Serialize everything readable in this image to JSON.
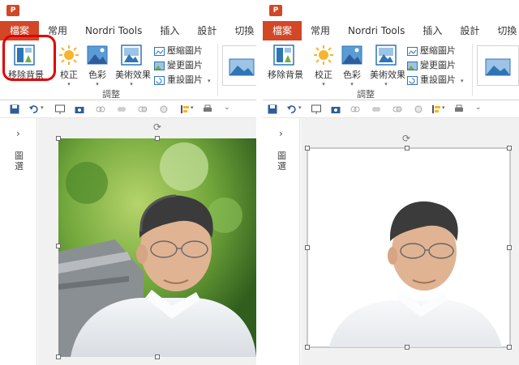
{
  "app_icon_letter": "P",
  "tabs": [
    "檔案",
    "常用",
    "Nordri Tools",
    "插入",
    "設計",
    "切換"
  ],
  "ribbon": {
    "remove_background": "移除背景",
    "corrections": "校正",
    "color": "色彩",
    "artistic_effects": "美術效果",
    "compress_pictures": "壓縮圖片",
    "change_picture": "變更圖片",
    "reset_picture": "重設圖片",
    "group_label": "調整"
  },
  "sidepane": {
    "arrow": "›",
    "label": "圖\n選"
  },
  "icons": {
    "app": "powerpoint-icon",
    "save": "save-icon",
    "undo": "undo-icon",
    "rotate": "rotate-handle-icon"
  },
  "colors": {
    "file_tab": "#d24726",
    "highlight": "#e30000",
    "ribbon_icon_blue": "#2e75b6"
  }
}
